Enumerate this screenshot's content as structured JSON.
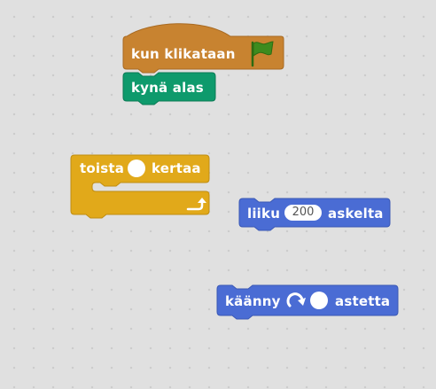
{
  "colors": {
    "workspace_bg": "#e0e0e0",
    "events": "#c88330",
    "pen": "#0e9a6c",
    "control": "#e1a91a",
    "motion": "#4a6cd4",
    "flag": "#3d8b1e"
  },
  "blocks": {
    "when_flag": {
      "label": "kun  klikataan",
      "icon": "green-flag-icon"
    },
    "pen_down": {
      "label": "kynä  alas"
    },
    "repeat": {
      "label_before": "toista",
      "count": "",
      "label_after": "kertaa",
      "icon": "loop-arrow-icon"
    },
    "move": {
      "label_before": "liiku",
      "steps": "200",
      "label_after": "askelta"
    },
    "turn": {
      "label_before": "käänny",
      "degrees": "",
      "label_after": "astetta",
      "icon": "rotate-clockwise-icon"
    }
  }
}
